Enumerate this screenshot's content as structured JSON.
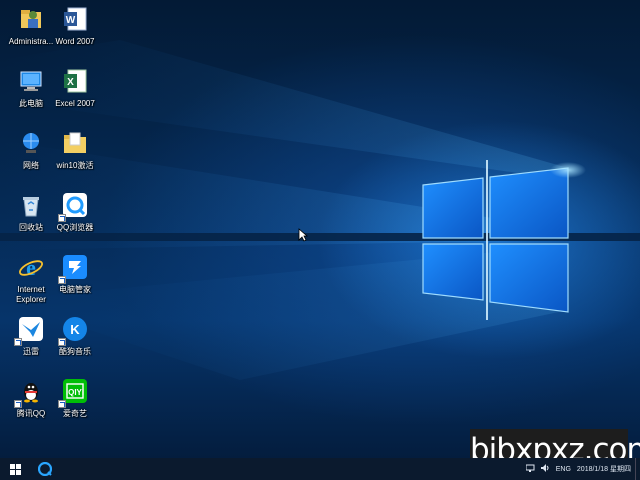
{
  "desktop": {
    "icons": [
      {
        "label": "Administra...",
        "icon": "user-folder-icon",
        "shortcut": false
      },
      {
        "label": "Word 2007",
        "icon": "word-icon",
        "shortcut": false
      },
      {
        "label": "此电脑",
        "icon": "computer-icon",
        "shortcut": false
      },
      {
        "label": "Excel 2007",
        "icon": "excel-icon",
        "shortcut": false
      },
      {
        "label": "网络",
        "icon": "network-icon",
        "shortcut": false
      },
      {
        "label": "win10激活",
        "icon": "folder-icon",
        "shortcut": false
      },
      {
        "label": "回收站",
        "icon": "recycle-bin-icon",
        "shortcut": false
      },
      {
        "label": "QQ浏览器",
        "icon": "qq-browser-icon",
        "shortcut": true
      },
      {
        "label": "Internet\nExplorer",
        "icon": "internet-explorer-icon",
        "shortcut": false
      },
      {
        "label": "电脑管家",
        "icon": "pc-manager-icon",
        "shortcut": true
      },
      {
        "label": "迅雷",
        "icon": "xunlei-icon",
        "shortcut": true
      },
      {
        "label": "酷狗音乐",
        "icon": "kugou-icon",
        "shortcut": true
      },
      {
        "label": "腾讯QQ",
        "icon": "qq-icon",
        "shortcut": true
      },
      {
        "label": "爱奇艺",
        "icon": "iqiyi-icon",
        "shortcut": true
      }
    ]
  },
  "taskbar": {
    "start_icon": "windows-start-icon",
    "pinned_app_icon": "qq-browser-icon",
    "tray": {
      "language": "ENG",
      "clock": "2018/1/18 星期四"
    }
  },
  "watermark": {
    "text": "bjbxpxz.com"
  },
  "colors": {
    "accent": "#0a78d7",
    "taskbar": "#0b1a2e"
  }
}
